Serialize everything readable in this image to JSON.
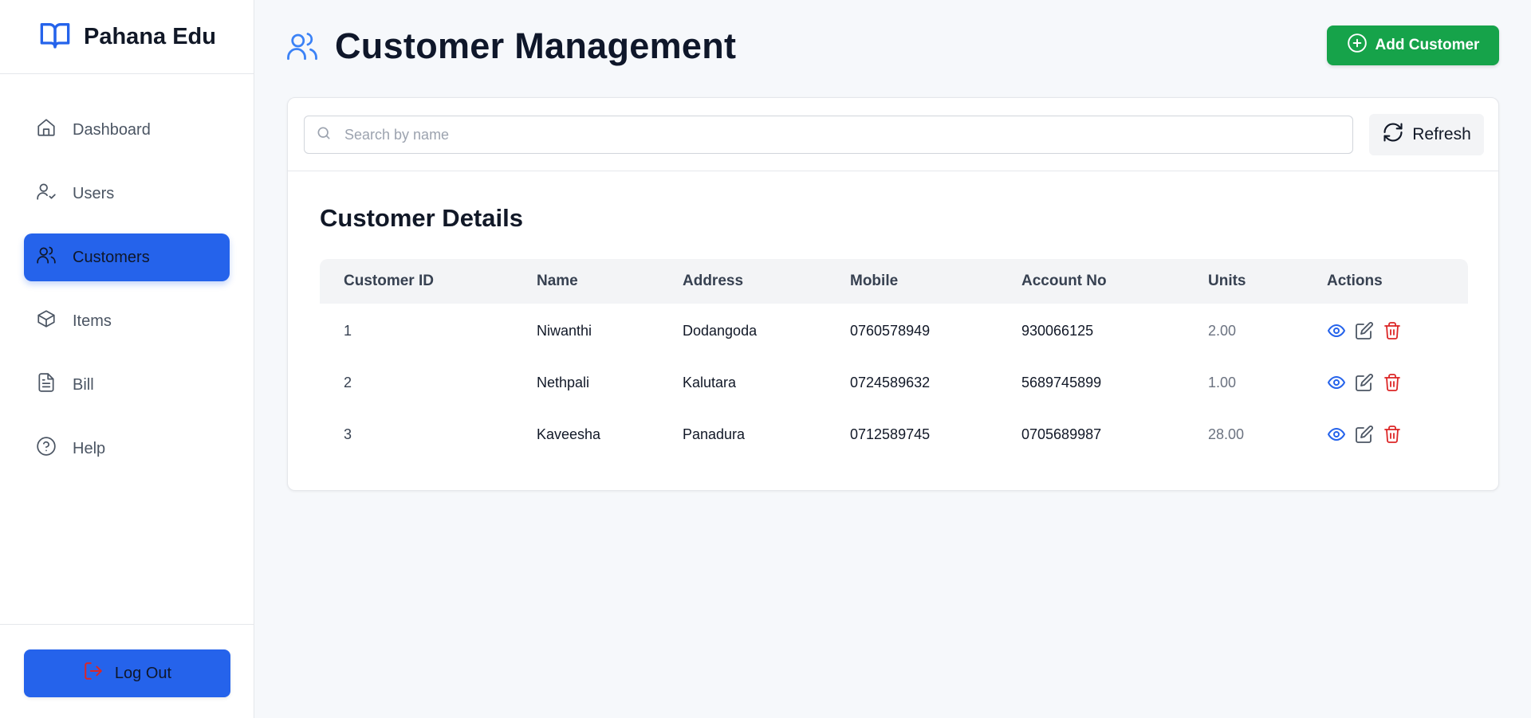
{
  "brand": {
    "name": "Pahana Edu"
  },
  "sidebar": {
    "items": [
      {
        "label": "Dashboard",
        "icon": "home-icon"
      },
      {
        "label": "Users",
        "icon": "user-check-icon"
      },
      {
        "label": "Customers",
        "icon": "users-icon",
        "active": true
      },
      {
        "label": "Items",
        "icon": "box-icon"
      },
      {
        "label": "Bill",
        "icon": "file-text-icon"
      },
      {
        "label": "Help",
        "icon": "help-circle-icon"
      }
    ],
    "logout_label": "Log Out"
  },
  "header": {
    "title": "Customer Management",
    "add_label": "Add Customer"
  },
  "search": {
    "placeholder": "Search by name"
  },
  "toolbar": {
    "refresh_label": "Refresh"
  },
  "section": {
    "title": "Customer Details"
  },
  "table": {
    "columns": [
      "Customer ID",
      "Name",
      "Address",
      "Mobile",
      "Account No",
      "Units",
      "Actions"
    ],
    "rows": [
      {
        "id": "1",
        "name": "Niwanthi",
        "address": "Dodangoda",
        "mobile": "0760578949",
        "account": "930066125",
        "units": "2.00"
      },
      {
        "id": "2",
        "name": "Nethpali",
        "address": "Kalutara",
        "mobile": "0724589632",
        "account": "5689745899",
        "units": "1.00"
      },
      {
        "id": "3",
        "name": "Kaveesha",
        "address": "Panadura",
        "mobile": "0712589745",
        "account": "0705689987",
        "units": "28.00"
      }
    ]
  },
  "colors": {
    "primary": "#2563eb",
    "success": "#16a34a",
    "danger": "#dc2626",
    "view_icon": "#2563eb",
    "edit_icon": "#4b5563"
  }
}
